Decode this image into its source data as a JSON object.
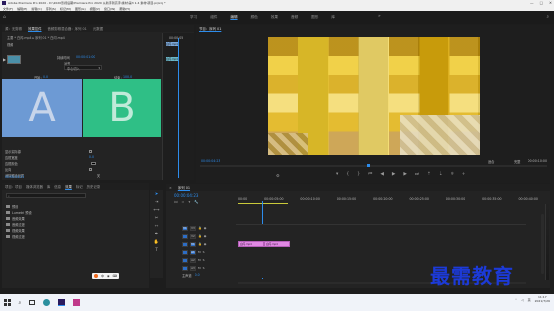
{
  "window": {
    "title": "Adobe Premiere Pro 2020 - D:\\2020影视后期\\Premiere Pro 2020 从新手到高手\\素材\\第3 1.4 素材\\项目.prproj *",
    "menu": [
      "文件(F)",
      "编辑(E)",
      "剪辑(C)",
      "序列(S)",
      "标记(M)",
      "图形(G)",
      "视图(V)",
      "窗口(W)",
      "帮助(H)"
    ],
    "controls": [
      "—",
      "□",
      "✕"
    ]
  },
  "workspaces": {
    "items": [
      "学习",
      "组件",
      "编辑",
      "颜色",
      "效果",
      "音频",
      "图形",
      "库"
    ],
    "active": "编辑"
  },
  "effect_controls": {
    "tabs": [
      "源：无剪辑",
      "效果控件",
      "音频剪辑混合器：序列 01",
      "元数据"
    ],
    "active_tab": "效果控件",
    "breadcrumb": "主要 * 白闪.mp4 ▸ 序列 01 * 白闪.mp4",
    "clip_label": "视频",
    "duration_label": "持续时间",
    "duration_value": "00:00:01:00",
    "alignment_label": "对齐",
    "alignment_value": "中心切入",
    "ab_labels": [
      "A",
      "B"
    ],
    "start_label": "开始：",
    "start_value": "0.0",
    "end_label": "结束：",
    "end_value": "100.0",
    "options": [
      "显示实际源",
      "边框宽度",
      "边框颜色",
      "反向",
      "消除锯齿品质"
    ],
    "edge_value": "0.0",
    "antialias_value": "关",
    "mini_timeline": {
      "clip1": "白闪.mp4",
      "clip2": "白闪.mp4",
      "timecode": "00:00:05"
    },
    "bottom_timecode": "00:00:04:23"
  },
  "program_monitor": {
    "title": "节目：序列 01",
    "timecode": "00:00:04:23",
    "fit": "适合",
    "quality": "完整",
    "duration": "00:00:10:00"
  },
  "project": {
    "tabs": [
      "项目：项目",
      "媒体浏览器",
      "库",
      "信息",
      "效果",
      "标记",
      "历史记录"
    ],
    "active_tab": "效果",
    "search_placeholder": "",
    "folders": [
      "预设",
      "Lumetri 预设",
      "音频效果",
      "音频过渡",
      "视频效果",
      "视频过渡"
    ]
  },
  "timeline": {
    "title": "序列 01",
    "timecode": "00:00:04:23",
    "ruler": [
      "00:00",
      "00:00:05:00",
      "00:00:10:00",
      "00:00:15:00",
      "00:00:20:00",
      "00:00:25:00",
      "00:00:30:00",
      "00:00:35:00",
      "00:00:40:00"
    ],
    "video_tracks": [
      "V3",
      "V2",
      "V1"
    ],
    "audio_tracks": [
      "A1",
      "A2",
      "A3"
    ],
    "master_label": "主声道",
    "master_value": "0.0",
    "clips": [
      "白闪.mp4",
      "白闪.mp4"
    ]
  },
  "watermark": {
    "text": "最需教育"
  },
  "taskbar": {
    "time": "11:17",
    "date": "2021/7/26",
    "lang": "英"
  },
  "colors": {
    "accent": "#2d8ceb",
    "slot_a": "#6d9ad4",
    "slot_b": "#2fbf86",
    "clip": "#e089e3",
    "watermark": "#1c3ad8"
  }
}
